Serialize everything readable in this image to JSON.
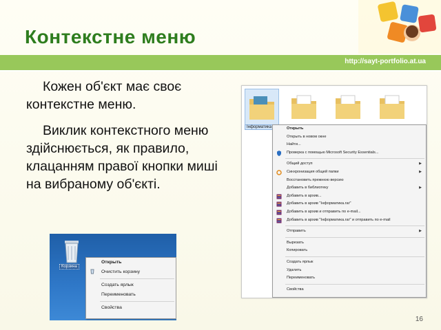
{
  "slide": {
    "title": "Контекстне меню",
    "url": "http://sayt-portfolio.at.ua",
    "paragraph1": "Кожен об'єкт має своє контекстне меню.",
    "paragraph2": "Виклик контекстного меню здійснюється, як правило, клацанням правої кнопки миші на вибраному об'єкті.",
    "page_number": "16"
  },
  "colors": {
    "title": "#2e7d1e",
    "bar": "#98c85a"
  },
  "right_screenshot": {
    "folder_caption": "Інформатика",
    "menu_items": [
      {
        "label": "Открыть",
        "bold": true
      },
      {
        "label": "Открыть в новом окне"
      },
      {
        "label": "Найти..."
      },
      {
        "label": "Проверка с помощью Microsoft Security Essentials...",
        "icon": "shield-icon"
      },
      {
        "sep": true
      },
      {
        "label": "Общий доступ",
        "arrow": true
      },
      {
        "label": "Синхронизация общей папки",
        "arrow": true,
        "icon": "sync-icon"
      },
      {
        "label": "Восстановить прежнюю версию"
      },
      {
        "label": "Добавить в библиотеку",
        "arrow": true
      },
      {
        "label": "Добавить в архив...",
        "icon": "archive-icon"
      },
      {
        "label": "Добавить в архив \"Інформатика.rar\"",
        "icon": "archive-icon"
      },
      {
        "label": "Добавить в архив и отправить по e-mail...",
        "icon": "archive-icon"
      },
      {
        "label": "Добавить в архив \"Інформатика.rar\" и отправить по e-mail",
        "icon": "archive-icon"
      },
      {
        "sep": true
      },
      {
        "label": "Отправить",
        "arrow": true
      },
      {
        "sep": true
      },
      {
        "label": "Вырезать"
      },
      {
        "label": "Копировать"
      },
      {
        "sep": true
      },
      {
        "label": "Создать ярлык"
      },
      {
        "label": "Удалить"
      },
      {
        "label": "Переименовать"
      },
      {
        "sep": true
      },
      {
        "label": "Свойства"
      }
    ]
  },
  "left_screenshot": {
    "icon_label": "Корзина",
    "menu_items": [
      {
        "label": "Открыть",
        "bold": true
      },
      {
        "label": "Очистить корзину",
        "icon": "recycle-icon"
      },
      {
        "sep": true
      },
      {
        "label": "Создать ярлык"
      },
      {
        "label": "Переименовать"
      },
      {
        "sep": true
      },
      {
        "label": "Свойства"
      }
    ]
  }
}
